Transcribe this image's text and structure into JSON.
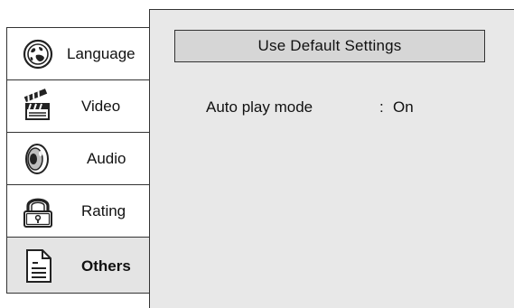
{
  "sidebar": {
    "items": [
      {
        "label": "Language",
        "icon": "globe-icon"
      },
      {
        "label": "Video",
        "icon": "clapperboard-icon"
      },
      {
        "label": "Audio",
        "icon": "speaker-icon"
      },
      {
        "label": "Rating",
        "icon": "padlock-icon"
      },
      {
        "label": "Others",
        "icon": "document-icon",
        "selected": true
      }
    ]
  },
  "main": {
    "default_button_label": "Use Default Settings",
    "settings": [
      {
        "label": "Auto play mode",
        "separator": ":",
        "value": "On"
      }
    ]
  },
  "colors": {
    "panel_background": "#e8e8e8",
    "selected_item_background": "#e4e4e4",
    "border": "#333333"
  }
}
